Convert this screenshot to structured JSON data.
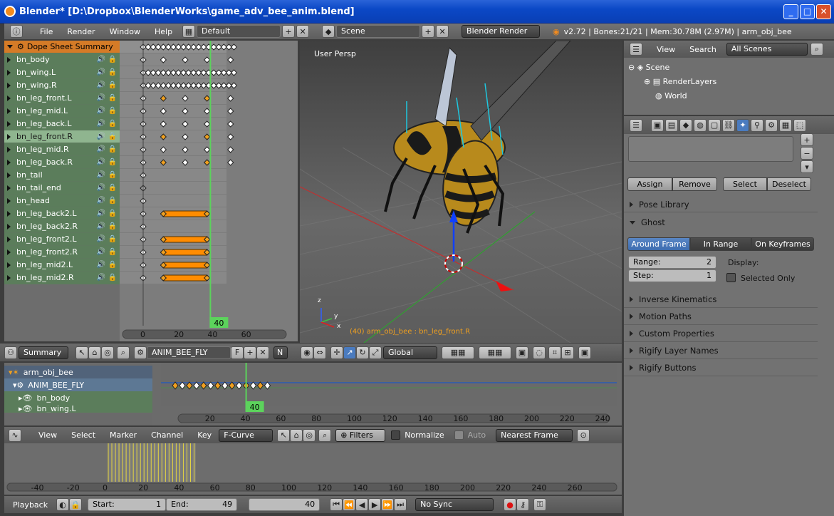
{
  "window": {
    "title": "Blender* [D:\\Dropbox\\BlenderWorks\\game_adv_bee_anim.blend]",
    "buttons": [
      "_",
      "□",
      "✕"
    ]
  },
  "info_header": {
    "menus": [
      "File",
      "Render",
      "Window",
      "Help"
    ],
    "layout": "Default",
    "scene": "Scene",
    "engine": "Blender Render",
    "stats": "v2.72 | Bones:21/21 | Mem:30.78M (2.97M) | arm_obj_bee"
  },
  "dopesheet": {
    "summary_label": "Dope Sheet Summary",
    "channels": [
      "bn_body",
      "bn_wing.L",
      "bn_wing.R",
      "bn_leg_front.L",
      "bn_leg_mid.L",
      "bn_leg_back.L",
      "bn_leg_front.R",
      "bn_leg_mid.R",
      "bn_leg_back.R",
      "bn_tail",
      "bn_tail_end",
      "bn_head",
      "bn_leg_back2.L",
      "bn_leg_back2.R",
      "bn_leg_front2.L",
      "bn_leg_front2.R",
      "bn_leg_mid2.L",
      "bn_leg_mid2.R"
    ],
    "selected_channel": "bn_leg_front.R",
    "ruler_ticks": [
      "0",
      "20",
      "40",
      "60"
    ],
    "current_frame": "40"
  },
  "viewport": {
    "label": "User Persp",
    "object_label": "(40) arm_obj_bee : bn_leg_front.R",
    "axes": {
      "x": "x",
      "y": "y",
      "z": "z"
    }
  },
  "outliner": {
    "menus": [
      "View",
      "Search"
    ],
    "filter": "All Scenes",
    "items": [
      "Scene",
      "RenderLayers",
      "World"
    ]
  },
  "properties": {
    "group_buttons": [
      "Assign",
      "Remove",
      "Select",
      "Deselect"
    ],
    "panels_top": [
      "Pose Library"
    ],
    "ghost": {
      "title": "Ghost",
      "modes": [
        "Around Frame",
        "In Range",
        "On Keyframes"
      ],
      "active_mode": "Around Frame",
      "range_label": "Range:",
      "range_value": "2",
      "step_label": "Step:",
      "step_value": "1",
      "display_label": "Display:",
      "selected_only": "Selected Only"
    },
    "panels_bottom": [
      "Inverse Kinematics",
      "Motion Paths",
      "Custom Properties",
      "Rigify Layer Names",
      "Rigify Buttons"
    ]
  },
  "dopesheet_header": {
    "mode": "Summary",
    "action": "ANIM_BEE_FLY",
    "action_f": "F",
    "n_label": "N",
    "orientation": "Global"
  },
  "nla": {
    "rows": [
      "arm_obj_bee",
      "ANIM_BEE_FLY",
      "bn_body",
      "bn_wing.L"
    ],
    "ticks": [
      "20",
      "40",
      "60",
      "80",
      "100",
      "120",
      "140",
      "160",
      "180",
      "200",
      "220",
      "240"
    ],
    "current_frame": "40"
  },
  "graph_header": {
    "menus": [
      "View",
      "Select",
      "Marker",
      "Channel",
      "Key"
    ],
    "mode": "F-Curve",
    "filters": "Filters",
    "normalize": "Normalize",
    "auto": "Auto",
    "snap": "Nearest Frame"
  },
  "timeline": {
    "ticks": [
      "-40",
      "-20",
      "0",
      "20",
      "40",
      "60",
      "80",
      "100",
      "120",
      "140",
      "160",
      "180",
      "200",
      "220",
      "240",
      "260"
    ]
  },
  "playback": {
    "label": "Playback",
    "start_label": "Start:",
    "start_value": "1",
    "end_label": "End:",
    "end_value": "49",
    "frame": "40",
    "sync": "No Sync"
  },
  "colors": {
    "accent_blue": "#4a7bbf",
    "keyframe_orange": "#f0a020",
    "frame_green": "#5cd35c"
  }
}
